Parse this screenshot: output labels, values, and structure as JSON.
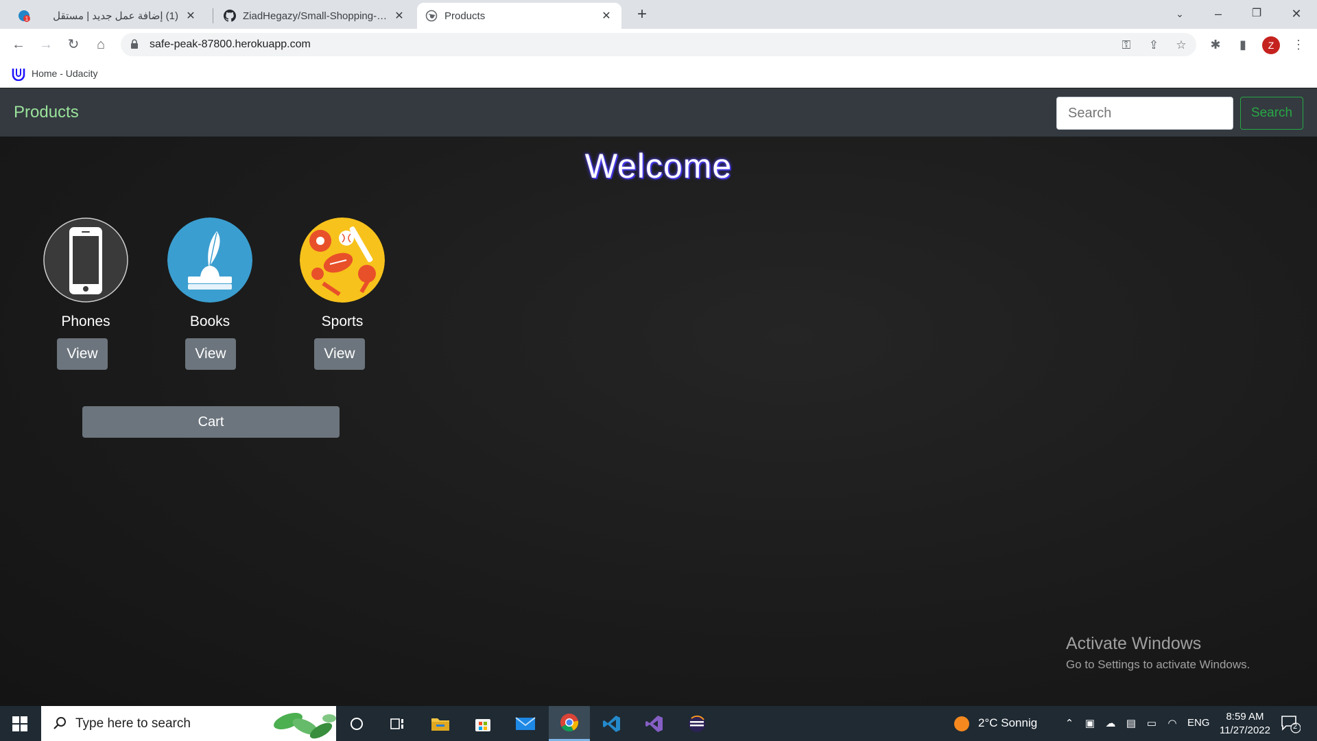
{
  "browser": {
    "tabs": [
      {
        "title": "(1) إضافة عمل جديد | مستقل",
        "active": false
      },
      {
        "title": "ZiadHegazy/Small-Shopping-Website",
        "active": false
      },
      {
        "title": "Products",
        "active": true
      }
    ],
    "new_tab_label": "+",
    "url": "safe-peak-87800.herokuapp.com",
    "profile_initial": "Z",
    "bookmarks": [
      {
        "label": "Home - Udacity"
      }
    ]
  },
  "page": {
    "brand": "Products",
    "search": {
      "placeholder": "Search",
      "button_label": "Search"
    },
    "welcome": "Welcome",
    "categories": [
      {
        "name": "Phones",
        "view_label": "View",
        "icon": "phone-icon"
      },
      {
        "name": "Books",
        "view_label": "View",
        "icon": "book-quill-icon"
      },
      {
        "name": "Sports",
        "view_label": "View",
        "icon": "sports-balls-icon"
      }
    ],
    "cart_label": "Cart",
    "colors": {
      "navbar": "#343a40",
      "brand": "#9be39b",
      "button": "#6c757d",
      "search_outline": "#28a745"
    }
  },
  "watermark": {
    "line1": "Activate Windows",
    "line2": "Go to Settings to activate Windows."
  },
  "taskbar": {
    "search_placeholder": "Type here to search",
    "weather": "2°C  Sonnig",
    "language": "ENG",
    "time": "8:59 AM",
    "date": "11/27/2022",
    "notification_count": "2"
  }
}
